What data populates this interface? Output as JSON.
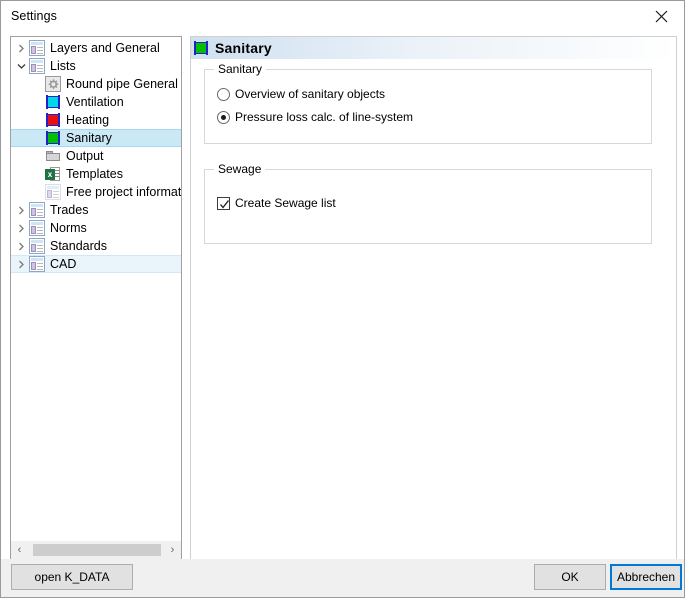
{
  "window": {
    "title": "Settings",
    "close_icon": "close-icon"
  },
  "tree": {
    "items": [
      {
        "label": "Layers and General",
        "level": 0,
        "icon": "window-icon",
        "chevron": "chevron-right-icon",
        "state": "normal"
      },
      {
        "label": "Lists",
        "level": 0,
        "icon": "window-icon",
        "chevron": "chevron-down-icon",
        "state": "normal"
      },
      {
        "label": "Round pipe General",
        "level": 1,
        "icon": "gear-icon",
        "chevron": "none",
        "state": "normal"
      },
      {
        "label": "Ventilation",
        "level": 1,
        "icon": "cyan-duct-icon",
        "chevron": "none",
        "state": "normal"
      },
      {
        "label": "Heating",
        "level": 1,
        "icon": "red-duct-icon",
        "chevron": "none",
        "state": "normal"
      },
      {
        "label": "Sanitary",
        "level": 1,
        "icon": "green-duct-icon",
        "chevron": "none",
        "state": "selected"
      },
      {
        "label": "Output",
        "level": 1,
        "icon": "folder-icon",
        "chevron": "none",
        "state": "normal"
      },
      {
        "label": "Templates",
        "level": 1,
        "icon": "excel-icon",
        "chevron": "none",
        "state": "normal"
      },
      {
        "label": "Free project informat",
        "level": 1,
        "icon": "window-pale-icon",
        "chevron": "none",
        "state": "normal"
      },
      {
        "label": "Trades",
        "level": 0,
        "icon": "window-icon",
        "chevron": "chevron-right-icon",
        "state": "normal"
      },
      {
        "label": "Norms",
        "level": 0,
        "icon": "window-icon",
        "chevron": "chevron-right-icon",
        "state": "normal"
      },
      {
        "label": "Standards",
        "level": 0,
        "icon": "window-icon",
        "chevron": "chevron-right-icon",
        "state": "normal"
      },
      {
        "label": "CAD",
        "level": 0,
        "icon": "window-icon",
        "chevron": "chevron-right-icon",
        "state": "hover"
      }
    ],
    "hscroll": {
      "left_arrow": "‹",
      "right_arrow": "›"
    }
  },
  "content": {
    "header_title": "Sanitary",
    "header_icon": "green-duct-icon",
    "groups": [
      {
        "title": "Sanitary",
        "options": [
          {
            "label": "Overview of sanitary objects",
            "type": "radio",
            "checked": false
          },
          {
            "label": "Pressure loss calc. of line-system",
            "type": "radio",
            "checked": true
          }
        ]
      },
      {
        "title": "Sewage",
        "options": [
          {
            "label": "Create Sewage list",
            "type": "checkbox",
            "checked": true
          }
        ]
      }
    ]
  },
  "footer": {
    "open_kdata_label": "open K_DATA",
    "ok_label": "OK",
    "cancel_label": "Abbrechen"
  },
  "colors": {
    "selection": "#cbe8f6",
    "hover": "#e9f4fb",
    "focus_border": "#0078d7",
    "sanitary_green": "#00c000",
    "ventilation_cyan": "#00d8e8",
    "heating_red": "#e81010",
    "duct_edge_blue": "#2222cc",
    "header_gradient_start": "#cfe0f0"
  }
}
